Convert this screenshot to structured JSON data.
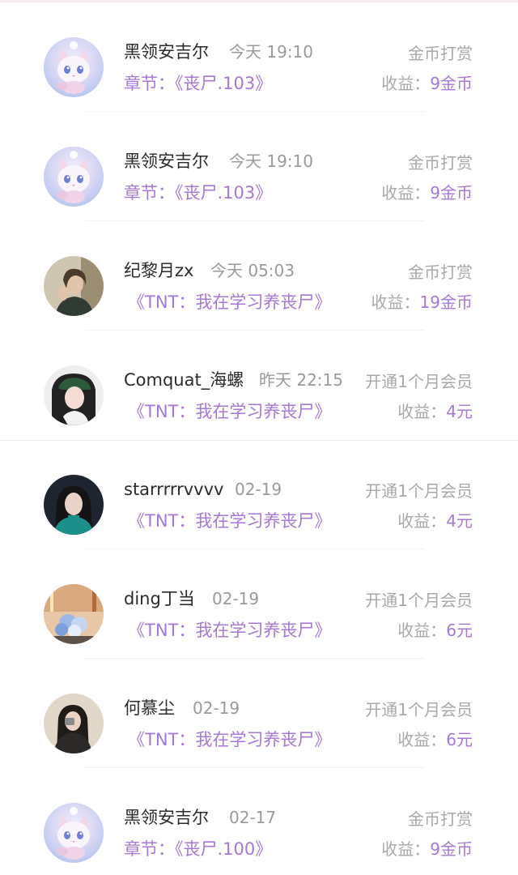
{
  "rows": [
    {
      "name": "黑领安吉尔",
      "time": "今天 19:10",
      "sub_prefix": "章节：",
      "sub_title": "《丧尸.103》",
      "type": "金币打赏",
      "income_label": "收益：",
      "income_value": "9金币",
      "avatar": "cat-avatar-icon"
    },
    {
      "name": "黑领安吉尔",
      "time": "今天 19:10",
      "sub_prefix": "章节：",
      "sub_title": "《丧尸.103》",
      "type": "金币打赏",
      "income_label": "收益：",
      "income_value": "9金币",
      "avatar": "cat-avatar-icon"
    },
    {
      "name": "纪黎月zx",
      "time": "今天 05:03",
      "sub_prefix": "",
      "sub_title": "《TNT：我在学习养丧尸》",
      "type": "金币打赏",
      "income_label": "收益：",
      "income_value": "19金币",
      "avatar": "person-avatar-icon"
    },
    {
      "name": "Comquat_海螺",
      "time": "昨天 22:15",
      "sub_prefix": "",
      "sub_title": "《TNT：我在学习养丧尸》",
      "type": "开通1个月会员",
      "income_label": "收益：",
      "income_value": "4元",
      "avatar": "person-avatar-icon"
    },
    {
      "name": "starrrrrvvvv",
      "time": "02-19",
      "sub_prefix": "",
      "sub_title": "《TNT：我在学习养丧尸》",
      "type": "开通1个月会员",
      "income_label": "收益：",
      "income_value": "4元",
      "avatar": "person-avatar-icon"
    },
    {
      "name": "ding丁当",
      "time": "02-19",
      "sub_prefix": "",
      "sub_title": "《TNT：我在学习养丧尸》",
      "type": "开通1个月会员",
      "income_label": "收益：",
      "income_value": "6元",
      "avatar": "flowers-avatar-icon"
    },
    {
      "name": "何慕尘",
      "time": "02-19",
      "sub_prefix": "",
      "sub_title": "《TNT：我在学习养丧尸》",
      "type": "开通1个月会员",
      "income_label": "收益：",
      "income_value": "6元",
      "avatar": "person-avatar-icon"
    },
    {
      "name": "黑领安吉尔",
      "time": "02-17",
      "sub_prefix": "章节：",
      "sub_title": "《丧尸.100》",
      "type": "金币打赏",
      "income_label": "收益：",
      "income_value": "9金币",
      "avatar": "cat-avatar-icon"
    }
  ],
  "colors": {
    "accent": "#a678d6",
    "text": "#2b2b2b",
    "muted": "#a8a8a8"
  }
}
